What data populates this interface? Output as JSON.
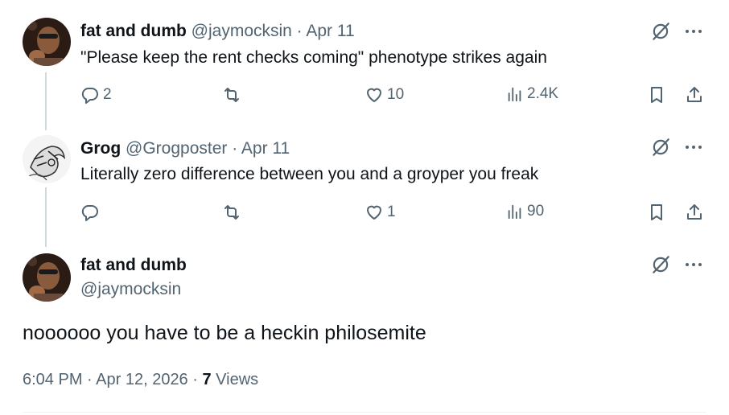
{
  "tweets": [
    {
      "name": "fat and dumb",
      "handle_date": "@jaymocksin · Apr 11",
      "text": "\"Please keep the rent checks coming\" phenotype strikes again",
      "replies": "2",
      "retweets": "",
      "likes": "10",
      "views": "2.4K"
    },
    {
      "name": "Grog",
      "handle_date": "@Grogposter · Apr 11",
      "text": "Literally zero difference between you and a groyper you freak",
      "replies": "",
      "retweets": "",
      "likes": "1",
      "views": "90"
    }
  ],
  "main": {
    "name": "fat and dumb",
    "handle": "@jaymocksin",
    "text": "noooooo you have to be a heckin philosemite",
    "timestamp": "6:04 PM · Apr 12, 2026 · ",
    "views_count": "7",
    "views_label": "Views"
  },
  "icons": {
    "reply": "reply-icon",
    "retweet": "retweet-icon",
    "like": "heart-icon",
    "views": "analytics-icon",
    "bookmark": "bookmark-icon",
    "share": "share-icon",
    "grok": "grok-icon",
    "more": "more-icon"
  },
  "colors": {
    "text": "#0f1419",
    "muted": "#536471",
    "thread_line": "#cfd9de"
  }
}
